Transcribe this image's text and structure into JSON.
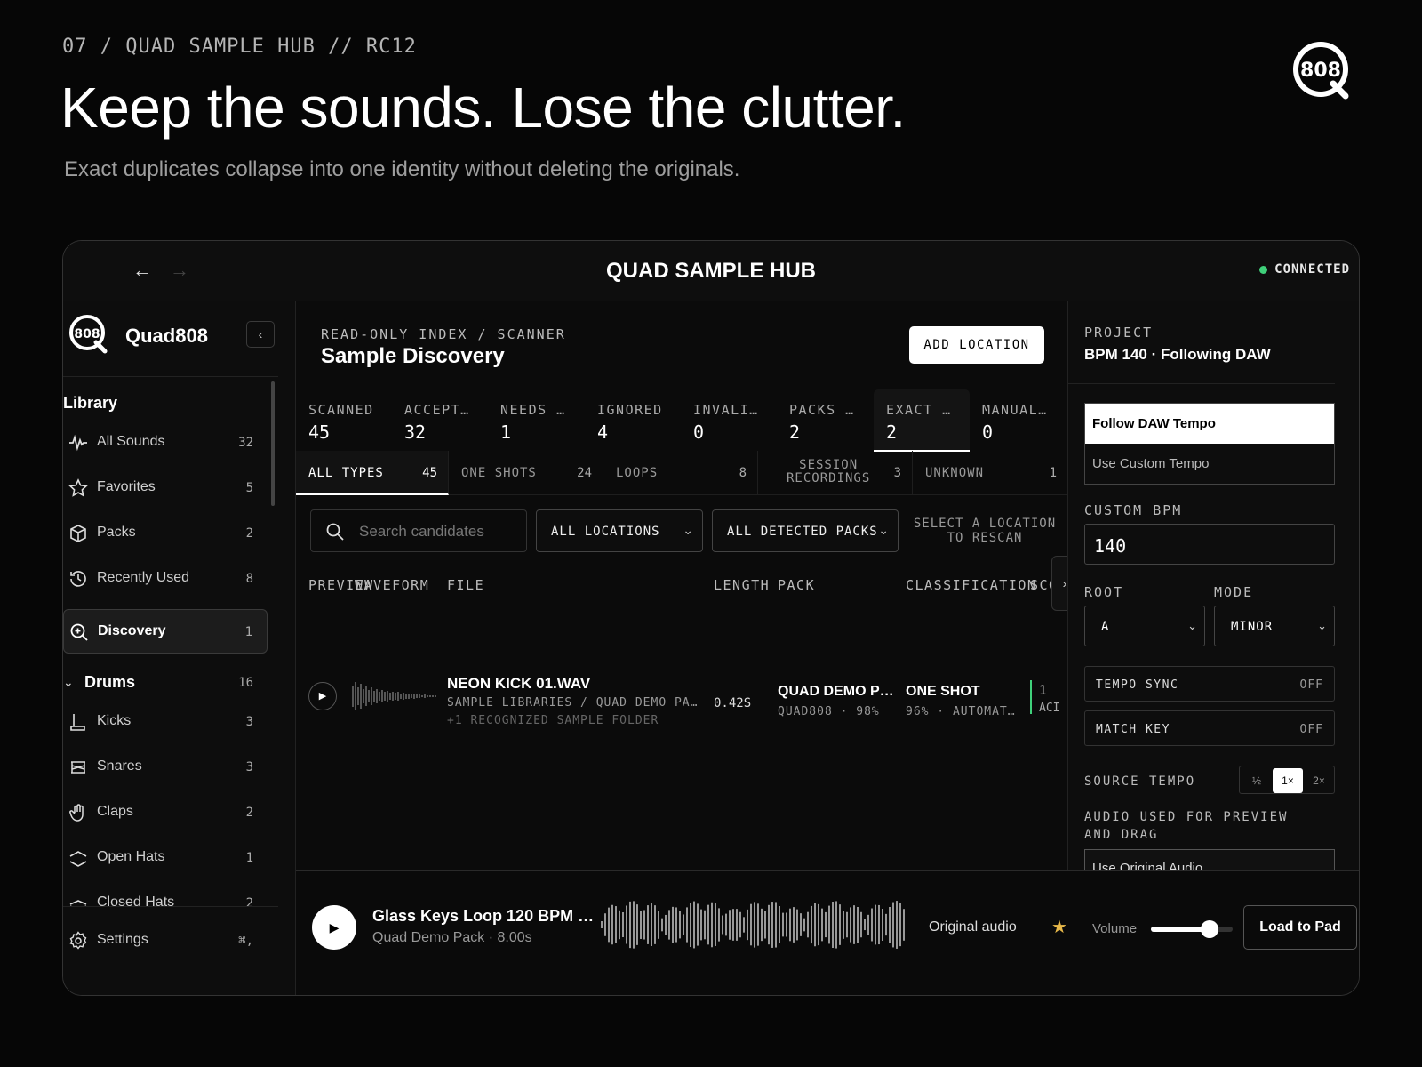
{
  "header": {
    "eyebrow": "07 / QUAD SAMPLE HUB // RC12",
    "headline": "Keep the sounds. Lose the clutter.",
    "subline": "Exact duplicates collapse into one identity without deleting the originals."
  },
  "window": {
    "title": "QUAD SAMPLE HUB",
    "status": "CONNECTED",
    "status_color": "#3fd07a"
  },
  "sidebar": {
    "brand": "Quad808",
    "library_label": "Library",
    "items": [
      {
        "label": "All Sounds",
        "count": "32",
        "icon": "waveform-icon"
      },
      {
        "label": "Favorites",
        "count": "5",
        "icon": "star-icon"
      },
      {
        "label": "Packs",
        "count": "2",
        "icon": "box-icon"
      },
      {
        "label": "Recently Used",
        "count": "8",
        "icon": "history-icon"
      },
      {
        "label": "Discovery",
        "count": "1",
        "icon": "discovery-icon"
      }
    ],
    "drums": {
      "label": "Drums",
      "count": "16",
      "items": [
        {
          "label": "Kicks",
          "count": "3",
          "icon": "kick-icon"
        },
        {
          "label": "Snares",
          "count": "3",
          "icon": "snare-icon"
        },
        {
          "label": "Claps",
          "count": "2",
          "icon": "hand-icon"
        },
        {
          "label": "Open Hats",
          "count": "1",
          "icon": "open-hat-icon"
        },
        {
          "label": "Closed Hats",
          "count": "2",
          "icon": "closed-hat-icon"
        }
      ]
    },
    "settings": {
      "label": "Settings",
      "shortcut": "⌘,"
    }
  },
  "main": {
    "eyebrow": "READ-ONLY INDEX / SCANNER",
    "title": "Sample Discovery",
    "add_location": "ADD LOCATION",
    "stats": [
      {
        "label": "SCANNED",
        "value": "45"
      },
      {
        "label": "ACCEPT…",
        "value": "32"
      },
      {
        "label": "NEEDS …",
        "value": "1"
      },
      {
        "label": "IGNORED",
        "value": "4"
      },
      {
        "label": "INVALI…",
        "value": "0"
      },
      {
        "label": "PACKS …",
        "value": "2"
      },
      {
        "label": "EXACT …",
        "value": "2"
      },
      {
        "label": "MANUAL…",
        "value": "0"
      }
    ],
    "types": [
      {
        "label": "ALL TYPES",
        "count": "45"
      },
      {
        "label": "ONE SHOTS",
        "count": "24"
      },
      {
        "label": "LOOPS",
        "count": "8"
      },
      {
        "label": "SESSION",
        "label2": "RECORDINGS",
        "count": "3"
      },
      {
        "label": "UNKNOWN",
        "count": "1"
      }
    ],
    "search_placeholder": "Search candidates",
    "location_filter": "ALL LOCATIONS",
    "pack_filter": "ALL DETECTED PACKS",
    "rescan_line1": "SELECT A LOCATION",
    "rescan_line2": "TO RESCAN",
    "columns": {
      "preview": "PREVIEW",
      "waveform": "WAVEFORM",
      "file": "FILE",
      "length": "LENGTH",
      "pack": "PACK",
      "classification": "CLASSIFICATION",
      "score": "SCO"
    },
    "row": {
      "file": "NEON KICK 01.WAV",
      "path": "SAMPLE LIBRARIES / QUAD DEMO PA…",
      "recognized": "+1 RECOGNIZED SAMPLE FOLDER",
      "length": "0.42S",
      "pack": "QUAD DEMO P…",
      "pack_sub": "QUAD808 · 98%",
      "classification": "ONE SHOT",
      "classification_sub": "96% · AUTOMAT…",
      "score": "1",
      "score_sub": "ACI"
    }
  },
  "right_panel": {
    "project_label": "PROJECT",
    "project_value": "BPM 140 · Following DAW",
    "tempo_options": [
      "Follow DAW Tempo",
      "Use Custom Tempo"
    ],
    "custom_bpm_label": "CUSTOM BPM",
    "custom_bpm_value": "140",
    "root_label": "ROOT",
    "root_value": "A",
    "mode_label": "MODE",
    "mode_value": "MINOR",
    "tempo_sync": {
      "label": "TEMPO SYNC",
      "value": "OFF"
    },
    "match_key": {
      "label": "MATCH KEY",
      "value": "OFF"
    },
    "source_tempo_label": "SOURCE TEMPO",
    "source_tempo_options": [
      "½",
      "1×",
      "2×"
    ],
    "audio_label": "AUDIO USED FOR PREVIEW AND DRAG",
    "audio_value": "Use Original Audio"
  },
  "player": {
    "title": "Glass Keys Loop 120 BPM …",
    "subtitle": "Quad Demo Pack · 8.00s",
    "original": "Original audio",
    "star": "★",
    "star_color": "#e8b94a",
    "volume_label": "Volume",
    "volume_level": 0.72,
    "load_button": "Load to Pad"
  }
}
